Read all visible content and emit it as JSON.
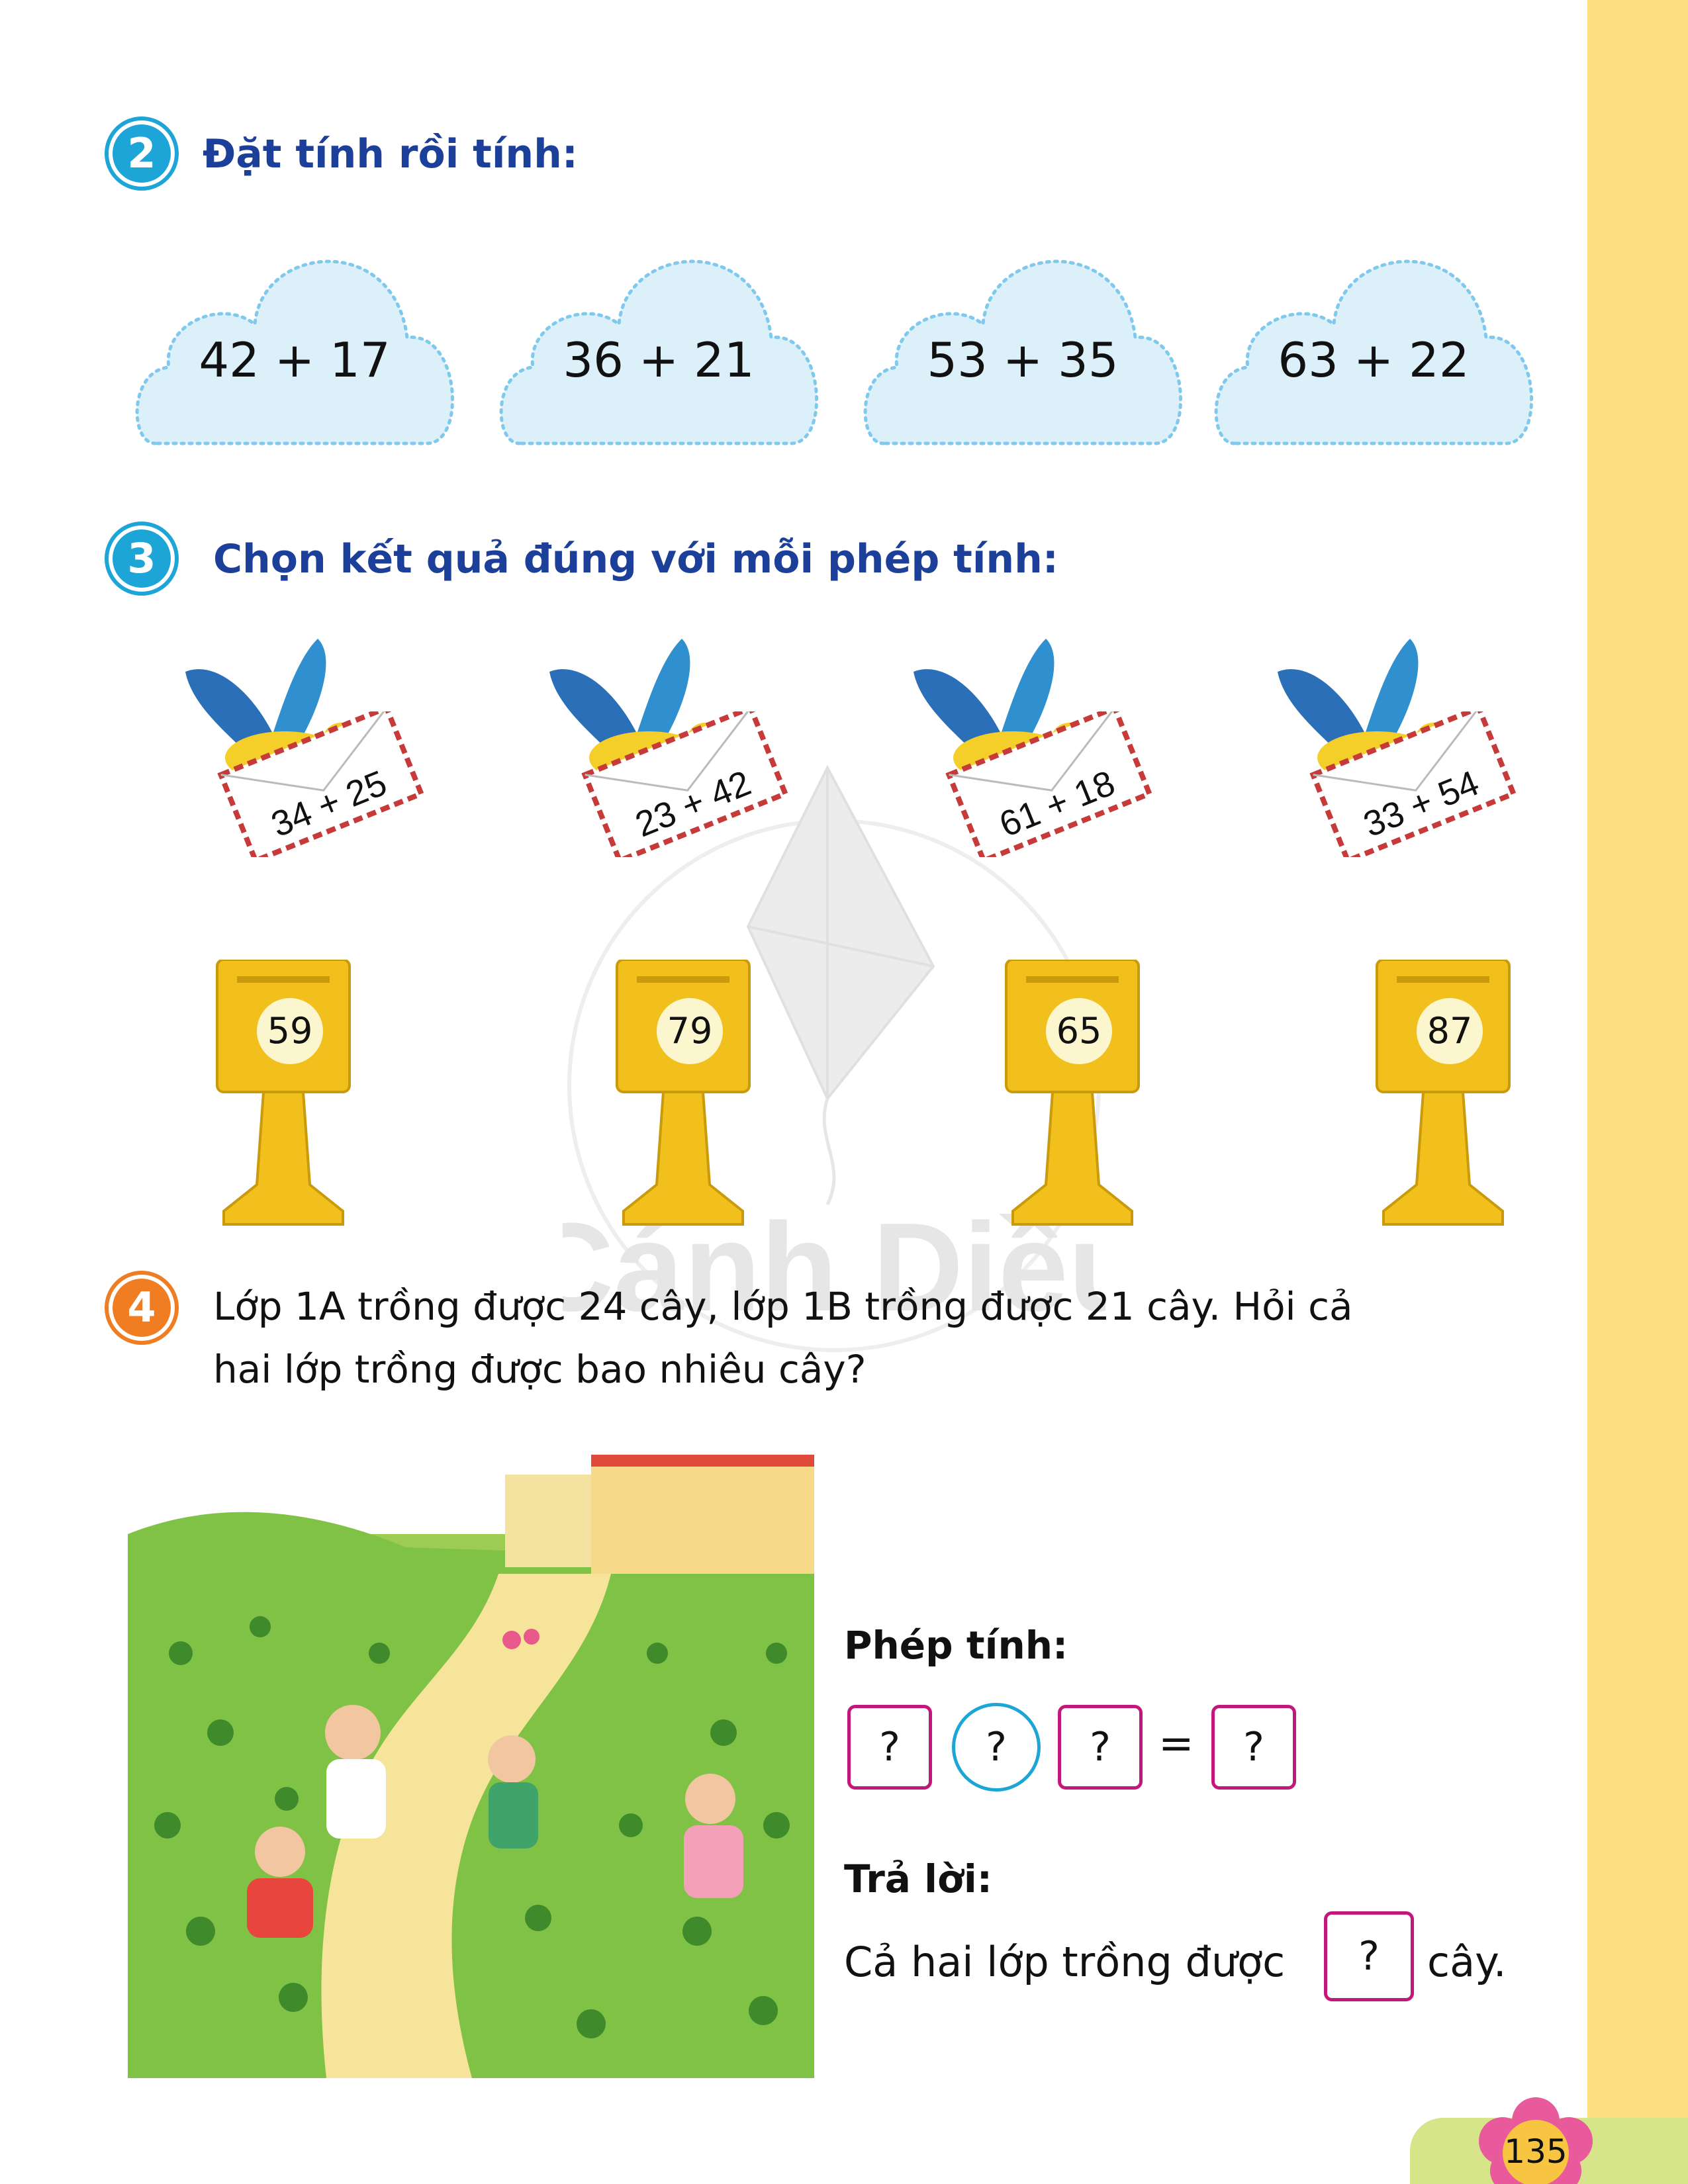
{
  "colors": {
    "sidebar": "#fbdf7e",
    "title_blue": "#1c3f9a",
    "badge_blue": "#1da5d8",
    "badge_orange": "#f07d22",
    "box_magenta": "#c2187c",
    "cloud_fill": "#dcf0fa",
    "mailbox": "#f2c01c"
  },
  "q2": {
    "number": "2",
    "title": "Đặt tính rồi tính:",
    "items": [
      "42 + 17",
      "36 + 21",
      "53 + 35",
      "63 + 22"
    ]
  },
  "q3": {
    "number": "3",
    "title": "Chọn kết quả đúng với mỗi phép tính:",
    "letters": [
      "34 + 25",
      "23 + 42",
      "61 + 18",
      "33 + 54"
    ],
    "mailboxes": [
      "59",
      "79",
      "65",
      "87"
    ]
  },
  "watermark": "Cánh Diều",
  "q4": {
    "number": "4",
    "line1": "Lớp 1A trồng được 24 cây, lớp 1B trồng được 21 cây. Hỏi cả",
    "line2": "hai lớp trồng được bao nhiêu cây?",
    "phep_tinh_label": "Phép tính:",
    "boxes": [
      "?",
      "?",
      "?"
    ],
    "equals": "=",
    "result": "?",
    "tra_loi_label": "Trả lời:",
    "answer_prefix": "Cả hai lớp trồng được",
    "answer_box": "?",
    "answer_suffix": "cây."
  },
  "page_number": "135"
}
